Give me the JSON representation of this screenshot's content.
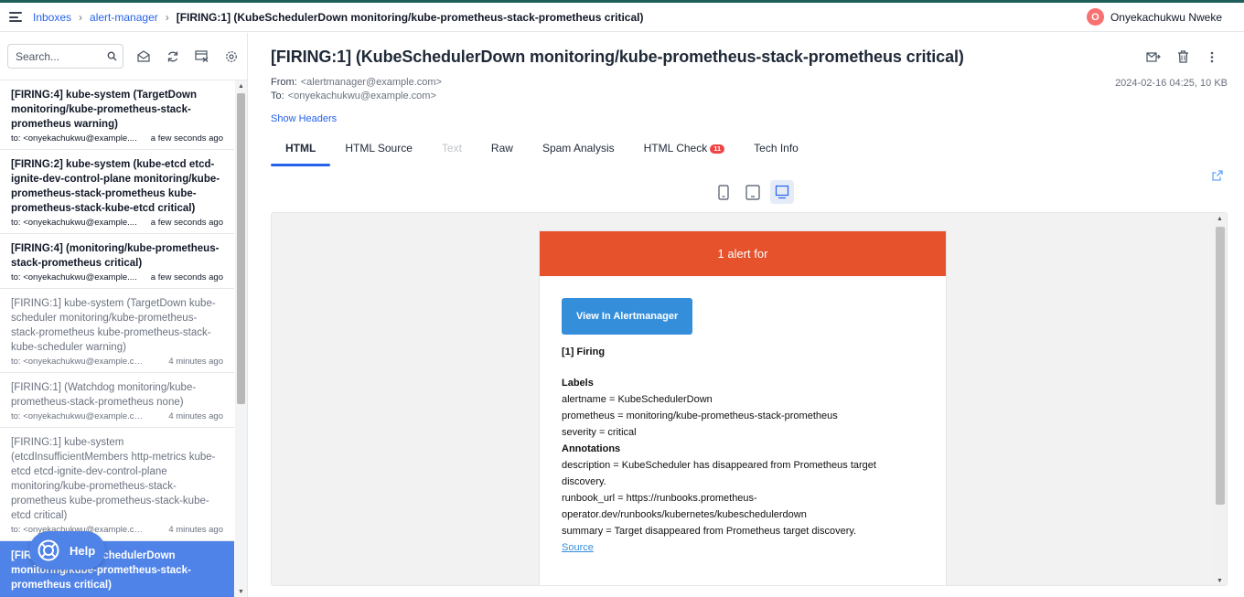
{
  "breadcrumb": {
    "root": "Inboxes",
    "inbox": "alert-manager",
    "current": "[FIRING:1] (KubeSchedulerDown monitoring/kube-prometheus-stack-prometheus critical)"
  },
  "user": {
    "initial": "O",
    "name": "Onyekachukwu Nweke"
  },
  "search": {
    "placeholder": "Search..."
  },
  "messages": [
    {
      "subject": "[FIRING:4] kube-system (TargetDown monitoring/kube-prometheus-stack-prometheus warning)",
      "to": "to: <onyekachukwu@example....",
      "time": "a few seconds ago"
    },
    {
      "subject": "[FIRING:2] kube-system (kube-etcd etcd-ignite-dev-control-plane monitoring/kube-prometheus-stack-prometheus kube-prometheus-stack-kube-etcd critical)",
      "to": "to: <onyekachukwu@example....",
      "time": "a few seconds ago"
    },
    {
      "subject": "[FIRING:4] (monitoring/kube-prometheus-stack-prometheus critical)",
      "to": "to: <onyekachukwu@example....",
      "time": "a few seconds ago"
    },
    {
      "subject": "[FIRING:1] kube-system (TargetDown kube-scheduler monitoring/kube-prometheus-stack-prometheus kube-prometheus-stack-kube-scheduler warning)",
      "to": "to: <onyekachukwu@example.com>",
      "time": "4 minutes ago"
    },
    {
      "subject": "[FIRING:1] (Watchdog monitoring/kube-prometheus-stack-prometheus none)",
      "to": "to: <onyekachukwu@example.com>",
      "time": "4 minutes ago"
    },
    {
      "subject": "[FIRING:1] kube-system (etcdInsufficientMembers http-metrics kube-etcd etcd-ignite-dev-control-plane monitoring/kube-prometheus-stack-prometheus kube-prometheus-stack-kube-etcd critical)",
      "to": "to: <onyekachukwu@example.com>",
      "time": "4 minutes ago"
    },
    {
      "subject": "[FIRING:1] (KubeSchedulerDown monitoring/kube-prometheus-stack-prometheus critical)",
      "to": "",
      "time": ""
    }
  ],
  "help": {
    "label": "Help"
  },
  "email": {
    "title": "[FIRING:1] (KubeSchedulerDown monitoring/kube-prometheus-stack-prometheus critical)",
    "from_label": "From:",
    "from": "<alertmanager@example.com>",
    "to_label": "To:",
    "to": "<onyekachukwu@example.com>",
    "date_size": "2024-02-16 04:25, 10 KB",
    "show_headers": "Show Headers"
  },
  "tabs": [
    {
      "label": "HTML"
    },
    {
      "label": "HTML Source"
    },
    {
      "label": "Text"
    },
    {
      "label": "Raw"
    },
    {
      "label": "Spam Analysis"
    },
    {
      "label": "HTML Check",
      "badge": "11"
    },
    {
      "label": "Tech Info"
    }
  ],
  "preview": {
    "header": "1 alert for",
    "button": "View In Alertmanager",
    "firing": "[1] Firing",
    "labels_heading": "Labels",
    "labels": [
      "alertname = KubeSchedulerDown",
      "prometheus = monitoring/kube-prometheus-stack-prometheus",
      "severity = critical"
    ],
    "annotations_heading": "Annotations",
    "annotations": [
      "description = KubeScheduler has disappeared from Prometheus target discovery.",
      "runbook_url = https://runbooks.prometheus-operator.dev/runbooks/kubernetes/kubeschedulerdown",
      "summary = Target disappeared from Prometheus target discovery."
    ],
    "source_link": "Source"
  },
  "colors": {
    "accent": "#2563eb",
    "selected": "#4f83e8",
    "alert_header": "#e6522c",
    "alert_button": "#348eda",
    "badge": "#ef4444"
  }
}
